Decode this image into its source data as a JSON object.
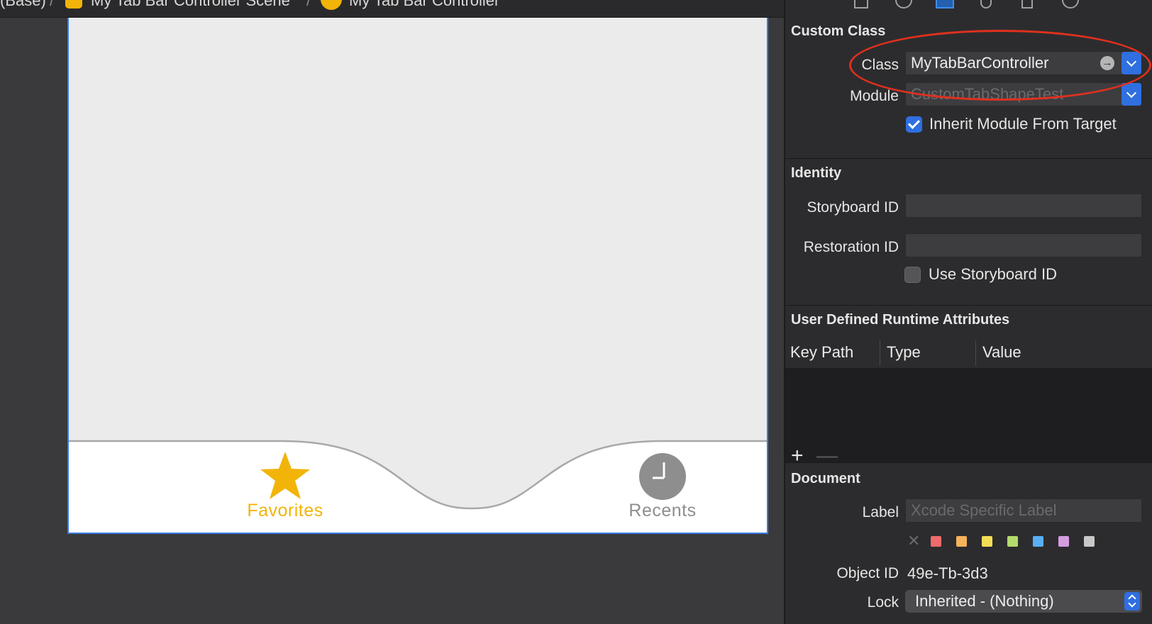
{
  "breadcrumb": {
    "items": [
      "(Base)",
      "My Tab Bar Controller Scene",
      "My Tab Bar Controller"
    ],
    "separator": "/",
    "icons": [
      "scene-icon",
      "controller-icon"
    ]
  },
  "canvas": {
    "tabs": [
      {
        "label": "Favorites",
        "icon": "star-icon",
        "color": "#f2b409"
      },
      {
        "label": "Recents",
        "icon": "clock-icon",
        "color": "#8e8e8e"
      }
    ]
  },
  "inspector": {
    "toolbar_icons": [
      "file-icon",
      "help-icon",
      "identity-icon",
      "attributes-icon",
      "size-icon",
      "connections-icon"
    ],
    "custom_class": {
      "title": "Custom Class",
      "class_label": "Class",
      "class_value": "MyTabBarController",
      "module_label": "Module",
      "module_placeholder": "CustomTabShapeTest",
      "inherit_label": "Inherit Module From Target",
      "inherit_checked": true
    },
    "identity": {
      "title": "Identity",
      "storyboard_id_label": "Storyboard ID",
      "storyboard_id_value": "",
      "restoration_id_label": "Restoration ID",
      "restoration_id_value": "",
      "use_storyboard_label": "Use Storyboard ID",
      "use_storyboard_checked": false
    },
    "runtime_attributes": {
      "title": "User Defined Runtime Attributes",
      "columns": [
        "Key Path",
        "Type",
        "Value"
      ],
      "add_label": "+",
      "remove_label": "—"
    },
    "document": {
      "title": "Document",
      "label_label": "Label",
      "label_placeholder": "Xcode Specific Label",
      "clear_label": "✕",
      "label_colors": [
        "#f06b6b",
        "#f5b35a",
        "#f2de56",
        "#b3dc6c",
        "#5aaef5",
        "#d59de0",
        "#c8c8c8"
      ],
      "object_id_label": "Object ID",
      "object_id_value": "49e-Tb-3d3",
      "lock_label": "Lock",
      "lock_value": "Inherited - (Nothing)"
    }
  },
  "colors": {
    "accent": "#2f6fe0",
    "annotation": "#e0301e",
    "tint": "#f2b409"
  }
}
